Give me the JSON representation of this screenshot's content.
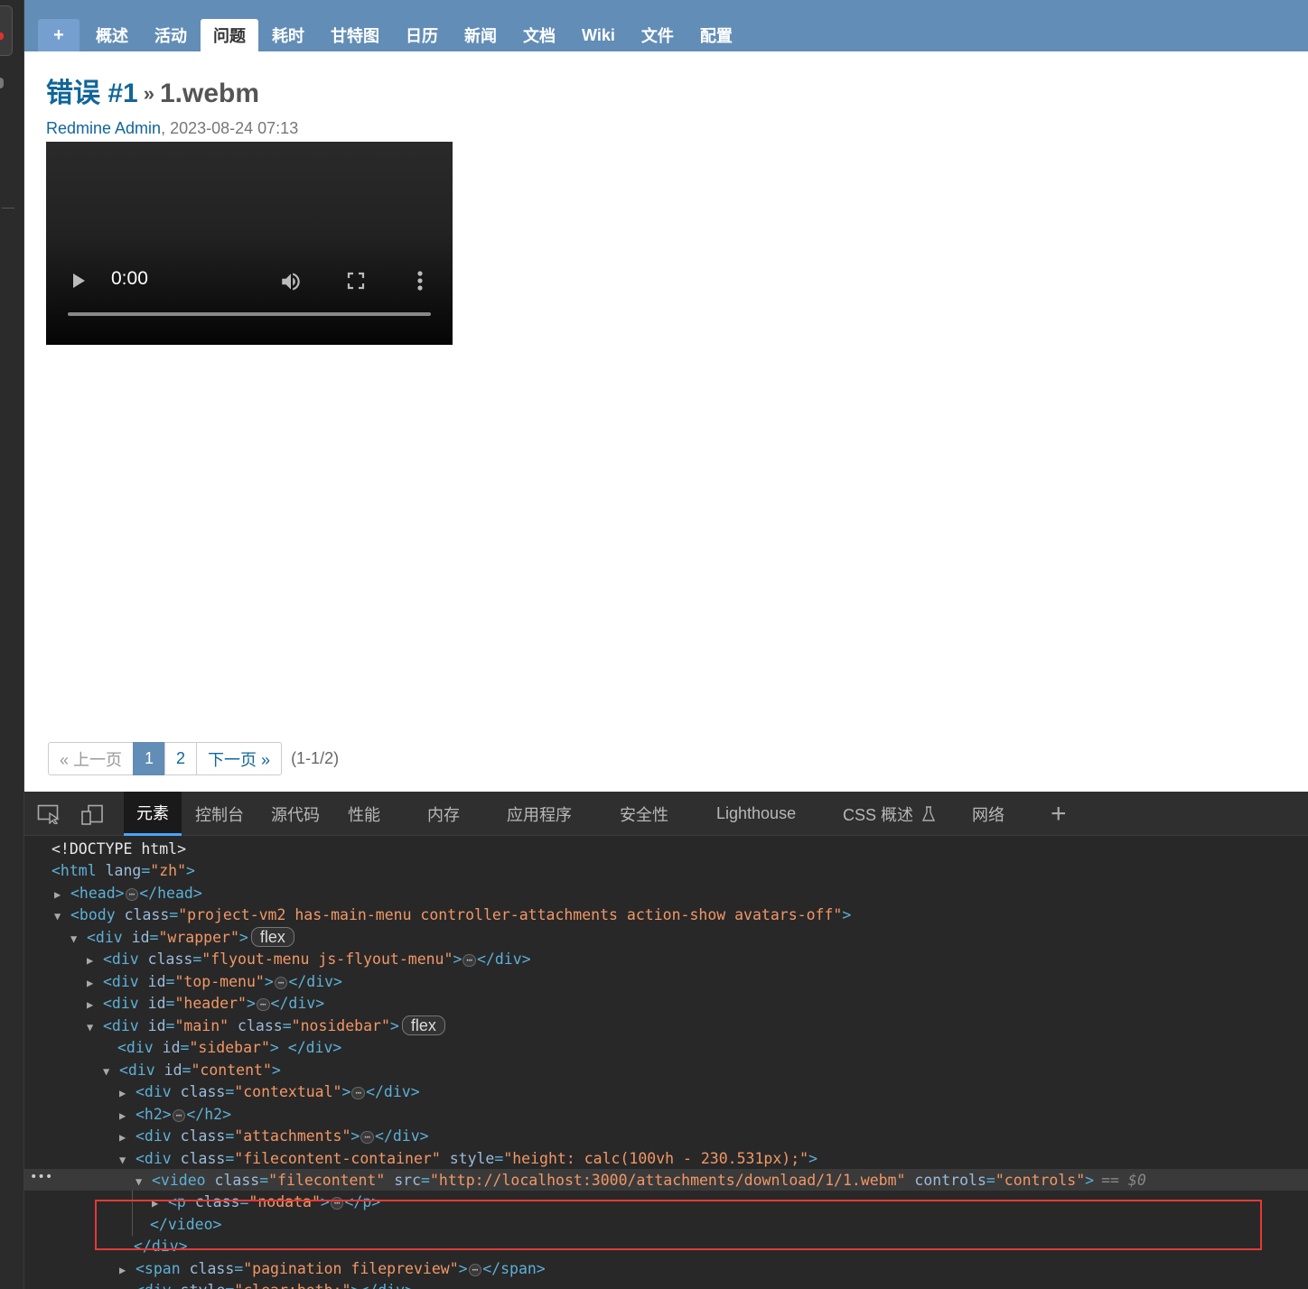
{
  "menu": {
    "new_label": "+",
    "items": [
      "概述",
      "活动",
      "问题",
      "耗时",
      "甘特图",
      "日历",
      "新闻",
      "文档",
      "Wiki",
      "文件",
      "配置"
    ],
    "selected": "问题"
  },
  "issue": {
    "tracker_number": "错误 #1",
    "separator": "»",
    "filename": "1.webm"
  },
  "attachment": {
    "author": "Redmine Admin",
    "date": ", 2023-08-24 07:13"
  },
  "video": {
    "time": "0:00",
    "progress": 0
  },
  "pagination": {
    "prev": "« 上一页",
    "pages": [
      "1",
      "2"
    ],
    "current": "1",
    "next": "下一页 »",
    "count": "(1-1/2)"
  },
  "devtools": {
    "tabs": [
      "元素",
      "控制台",
      "源代码",
      "性能",
      "内存",
      "应用程序",
      "安全性",
      "Lighthouse",
      "CSS 概述",
      "网络"
    ],
    "active_tab": "元素",
    "add_tab_label": "+",
    "selected_suffix": "== $0",
    "badge_flex": "flex",
    "dom_lines": [
      "<!DOCTYPE html>",
      "<html lang=\"zh\">",
      "<head> … </head>",
      "<body class=\"project-vm2 has-main-menu controller-attachments action-show avatars-off\">",
      "<div id=\"wrapper\"> flex",
      "<div class=\"flyout-menu js-flyout-menu\"> … </div>",
      "<div id=\"top-menu\"> … </div>",
      "<div id=\"header\"> … </div>",
      "<div id=\"main\" class=\"nosidebar\"> flex",
      "<div id=\"sidebar\"> </div>",
      "<div id=\"content\">",
      "<div class=\"contextual\"> … </div>",
      "<h2> … </h2>",
      "<div class=\"attachments\"> … </div>",
      "<div class=\"filecontent-container\" style=\"height: calc(100vh - 230.531px);\">",
      "<video class=\"filecontent\" src=\"http://localhost:3000/attachments/download/1/1.webm\" controls=\"controls\">",
      "<p class=\"nodata\"> … </p>",
      "</video>",
      "</div>",
      "<span class=\"pagination filepreview\"> … </span>",
      "<div style=\"clear:both;\"></div>"
    ]
  }
}
